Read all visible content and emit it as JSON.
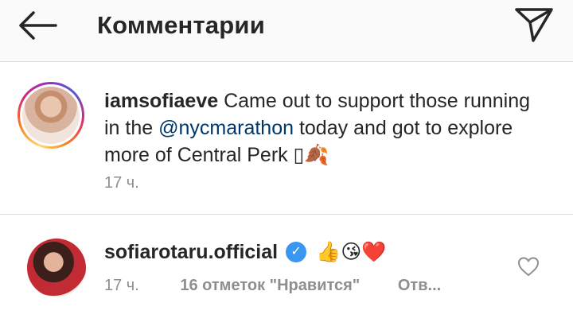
{
  "header": {
    "title": "Комментарии",
    "back_icon": "arrow-left-icon",
    "send_icon": "paper-plane-icon"
  },
  "caption": {
    "username": "iamsofiaeve",
    "text_before": " Came out to support those running in the ",
    "mention": "@nycmarathon",
    "text_after": " today and got to explore more of Central Perk ",
    "missing_glyph": "▯",
    "emoji": "🍂",
    "time": "17 ч.",
    "avatar_icon": "story-ring-avatar"
  },
  "comment": {
    "username": "sofiarotaru.official",
    "verified_icon": "verified-badge-icon",
    "verified_glyph": "✓",
    "emojis": "👍😘❤️",
    "time": "17 ч.",
    "likes": "16 отметок \"Нравится\"",
    "reply": "Отв...",
    "like_icon": "heart-outline-icon"
  },
  "colors": {
    "mention": "#00376b",
    "secondary_text": "#8e8e8e",
    "verified": "#3897f0",
    "header_bg": "#fafafa",
    "divider": "#dbdbdb"
  }
}
